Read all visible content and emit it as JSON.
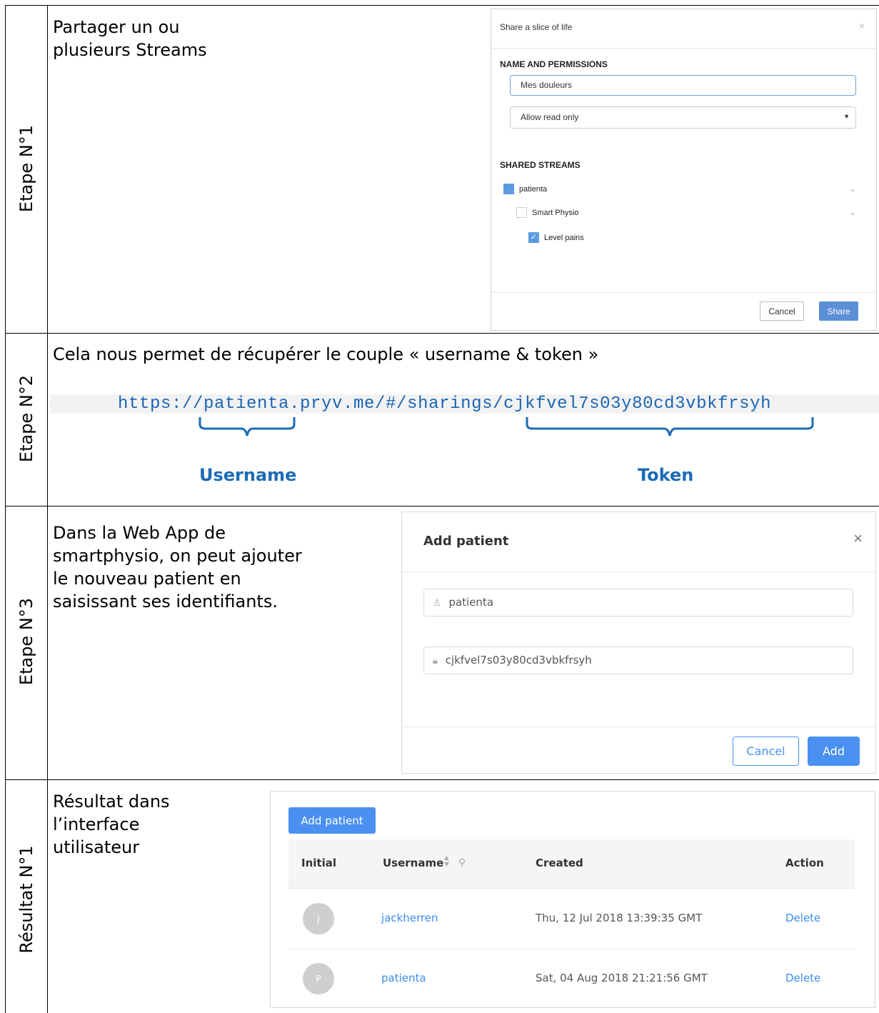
{
  "rows": [
    {
      "label": "Etape N°1",
      "text": [
        "Partager un ou",
        "plusieurs Streams"
      ]
    },
    {
      "label": "Etape N°2",
      "text": [
        "Cela nous permet de récupérer le couple « username & token »"
      ]
    },
    {
      "label": "Etape N°3",
      "text": [
        "Dans la Web App de",
        "smartphysio, on peut ajouter",
        "le nouveau patient en",
        "saisissant ses identifiants."
      ]
    },
    {
      "label": "Résultat N°1",
      "text": [
        "Résultat dans",
        "l’interface",
        "utilisateur"
      ]
    }
  ],
  "share_dialog": {
    "title": "Share a slice of life",
    "close_icon": "×",
    "section_name": "NAME AND PERMISSIONS",
    "name_value": "Mes douleurs",
    "permission_value": "Allow read only",
    "section_streams": "SHARED STREAMS",
    "streams": [
      {
        "label": "patienta",
        "state": "filled"
      },
      {
        "label": "Smart Physio",
        "state": "empty"
      },
      {
        "label": "Level pains",
        "state": "checked"
      }
    ],
    "cancel_label": "Cancel",
    "share_label": "Share",
    "accent": "#5b8fd6"
  },
  "url": {
    "text": "https://patienta.pryv.me/#/sharings/cjkfvel7s03y80cd3vbkfrsyh",
    "username_label": "Username",
    "token_label": "Token",
    "color": "#1c6bb5"
  },
  "add_dialog": {
    "title": "Add patient",
    "close_icon": "×",
    "username_value": "patienta",
    "token_value": "cjkfvel7s03y80cd3vbkfrsyh",
    "cancel_label": "Cancel",
    "add_label": "Add"
  },
  "patients_table": {
    "add_button": "Add patient",
    "columns": [
      "Initial",
      "Username",
      "Created",
      "Action"
    ],
    "rows": [
      {
        "initial": "J",
        "username": "jackherren",
        "created": "Thu, 12 Jul 2018 13:39:35 GMT",
        "action": "Delete"
      },
      {
        "initial": "P",
        "username": "patienta",
        "created": "Sat, 04 Aug 2018 21:21:56 GMT",
        "action": "Delete"
      }
    ]
  }
}
